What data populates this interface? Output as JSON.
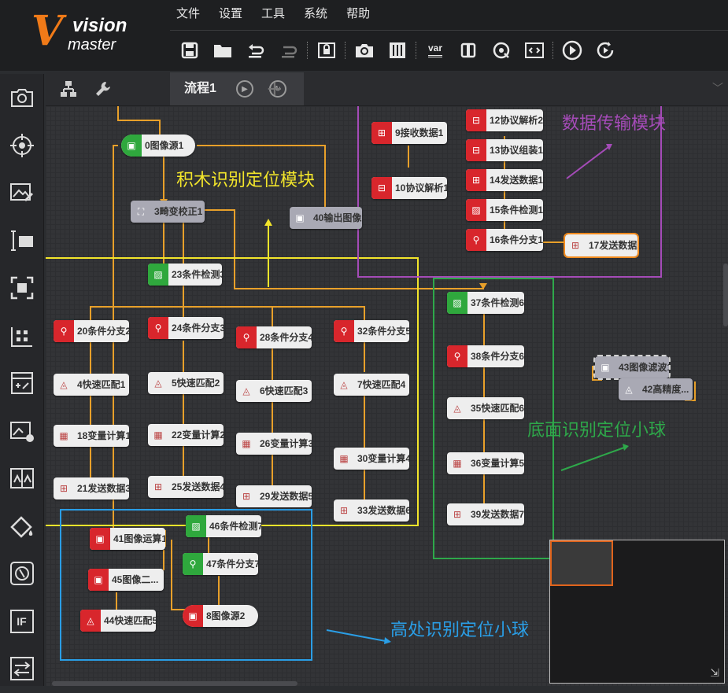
{
  "app": {
    "logo_text_1": "vision",
    "logo_text_2": "master",
    "colors": {
      "accent": "#f07a18",
      "topbar": "#1e1f21",
      "canvas": "#333437",
      "node_red": "#d8262c",
      "node_green": "#2fa83d"
    }
  },
  "menu": [
    "文件",
    "设置",
    "工具",
    "系统",
    "帮助"
  ],
  "toolbar_icons": [
    "save-icon",
    "open-folder-icon",
    "undo-icon",
    "redo-icon",
    "lock-icon",
    "camera-icon",
    "controls-icon",
    "var-icon",
    "device-icon",
    "refresh-target-icon",
    "code-icon",
    "run-once-icon",
    "run-loop-icon"
  ],
  "toolbar": {
    "var_label": "var"
  },
  "left_tools": [
    "camera-tool-icon",
    "locate-target-icon",
    "image-edit-icon",
    "measure-icon",
    "recognize-icon",
    "calibrate-icon",
    "calculate-icon",
    "image-process-icon",
    "compare-icon",
    "color-icon",
    "defect-icon",
    "logic-if-icon",
    "communication-icon"
  ],
  "left_tools_if_label": "IF",
  "tabs": {
    "flow_name": "流程1",
    "add_symbol": "+"
  },
  "nodes": [
    {
      "id": "n0",
      "label": "0图像源1",
      "style": "green pill",
      "icon": "▣"
    },
    {
      "id": "n3",
      "label": "3畸变校正1",
      "style": "gray",
      "icon": "⛶"
    },
    {
      "id": "n40",
      "label": "40输出图像1",
      "style": "gray",
      "icon": "▣"
    },
    {
      "id": "n23",
      "label": "23条件检测3",
      "style": "green",
      "icon": "▨"
    },
    {
      "id": "n20",
      "label": "20条件分支2",
      "style": "red",
      "icon": "⚲"
    },
    {
      "id": "n24",
      "label": "24条件分支3",
      "style": "red",
      "icon": "⚲"
    },
    {
      "id": "n28",
      "label": "28条件分支4",
      "style": "red",
      "icon": "⚲"
    },
    {
      "id": "n32",
      "label": "32条件分支5",
      "style": "red",
      "icon": "⚲"
    },
    {
      "id": "n4",
      "label": "4快速匹配1",
      "style": "plain",
      "icon": "◬"
    },
    {
      "id": "n5",
      "label": "5快速匹配2",
      "style": "plain",
      "icon": "◬"
    },
    {
      "id": "n6",
      "label": "6快速匹配3",
      "style": "plain",
      "icon": "◬"
    },
    {
      "id": "n7",
      "label": "7快速匹配4",
      "style": "plain",
      "icon": "◬"
    },
    {
      "id": "n18",
      "label": "18变量计算1",
      "style": "plain",
      "icon": "▦"
    },
    {
      "id": "n22",
      "label": "22变量计算2",
      "style": "plain",
      "icon": "▦"
    },
    {
      "id": "n26",
      "label": "26变量计算3",
      "style": "plain",
      "icon": "▦"
    },
    {
      "id": "n30",
      "label": "30变量计算4",
      "style": "plain",
      "icon": "▦"
    },
    {
      "id": "n21",
      "label": "21发送数据3",
      "style": "plain",
      "icon": "⊞"
    },
    {
      "id": "n25",
      "label": "25发送数据4",
      "style": "plain",
      "icon": "⊞"
    },
    {
      "id": "n29",
      "label": "29发送数据5",
      "style": "plain",
      "icon": "⊞"
    },
    {
      "id": "n33",
      "label": "33发送数据6",
      "style": "plain",
      "icon": "⊞"
    },
    {
      "id": "n9",
      "label": "9接收数据1",
      "style": "red",
      "icon": "⊞"
    },
    {
      "id": "n10",
      "label": "10协议解析1",
      "style": "red",
      "icon": "⊟"
    },
    {
      "id": "n12",
      "label": "12协议解析2",
      "style": "red",
      "icon": "⊟"
    },
    {
      "id": "n13",
      "label": "13协议组装1",
      "style": "red",
      "icon": "⊟"
    },
    {
      "id": "n14",
      "label": "14发送数据1",
      "style": "red",
      "icon": "⊞"
    },
    {
      "id": "n15",
      "label": "15条件检测1",
      "style": "red",
      "icon": "▨"
    },
    {
      "id": "n16",
      "label": "16条件分支1",
      "style": "red",
      "icon": "⚲"
    },
    {
      "id": "n17",
      "label": "17发送数据2",
      "style": "plain sel",
      "icon": "⊞"
    },
    {
      "id": "n37",
      "label": "37条件检测6",
      "style": "green",
      "icon": "▨"
    },
    {
      "id": "n38",
      "label": "38条件分支6",
      "style": "red",
      "icon": "⚲"
    },
    {
      "id": "n35",
      "label": "35快速匹配6",
      "style": "plain",
      "icon": "◬"
    },
    {
      "id": "n36",
      "label": "36变量计算5",
      "style": "plain",
      "icon": "▦"
    },
    {
      "id": "n39",
      "label": "39发送数据7",
      "style": "plain",
      "icon": "⊞"
    },
    {
      "id": "n43",
      "label": "43图像滤波1",
      "style": "gray dashed",
      "icon": "▣"
    },
    {
      "id": "n42",
      "label": "42高精度...",
      "style": "gray",
      "icon": "◬"
    },
    {
      "id": "n41",
      "label": "41图像运算1",
      "style": "red",
      "icon": "▣"
    },
    {
      "id": "n46",
      "label": "46条件检测7",
      "style": "green",
      "icon": "▨"
    },
    {
      "id": "n47",
      "label": "47条件分支7",
      "style": "green",
      "icon": "⚲"
    },
    {
      "id": "n45",
      "label": "45图像二...",
      "style": "red",
      "icon": "▣"
    },
    {
      "id": "n44",
      "label": "44快速匹配5",
      "style": "red",
      "icon": "◬"
    },
    {
      "id": "n8",
      "label": "8图像源2",
      "style": "red pill",
      "icon": "▣"
    }
  ],
  "annotations": {
    "block_module": "积木识别定位模块",
    "data_module": "数据传输模块",
    "bottom_ball": "底面识别定位小球",
    "high_ball": "高处识别定位小球",
    "colors": {
      "yellow": "#f2e52b",
      "purple": "#a54bb8",
      "green": "#2ea84a",
      "blue": "#2a9ee6"
    }
  }
}
